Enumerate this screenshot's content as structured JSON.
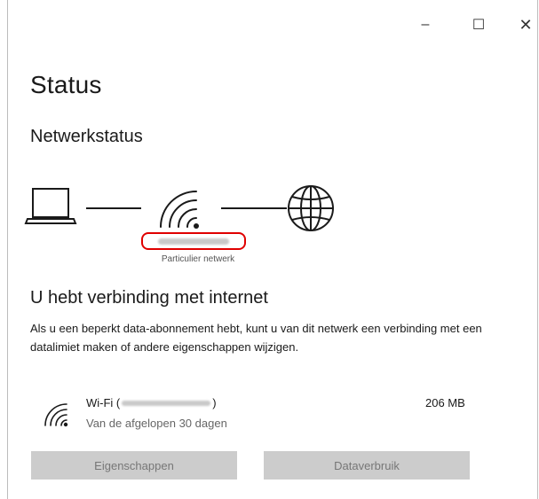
{
  "titlebar": {
    "minimize_glyph": "–",
    "maximize_glyph": "☐",
    "close_glyph": "✕"
  },
  "page": {
    "title": "Status",
    "section_title": "Netwerkstatus"
  },
  "diagram": {
    "icons": [
      "laptop-icon",
      "wifi-icon",
      "globe-icon"
    ],
    "network_type": "Particulier netwerk"
  },
  "connection": {
    "title": "U hebt verbinding met internet",
    "description": "Als u een beperkt data-abonnement hebt, kunt u van dit netwerk een verbinding met een datalimiet maken of andere eigenschappen wijzigen."
  },
  "wifi": {
    "name_prefix": "Wi-Fi (",
    "name_suffix": ")",
    "subtitle": "Van de afgelopen 30 dagen",
    "usage": "206 MB"
  },
  "buttons": {
    "properties": "Eigenschappen",
    "data_usage": "Dataverbruik"
  },
  "colors": {
    "highlight": "#e00000",
    "button_bg": "#cccccc",
    "button_text": "#777777"
  }
}
